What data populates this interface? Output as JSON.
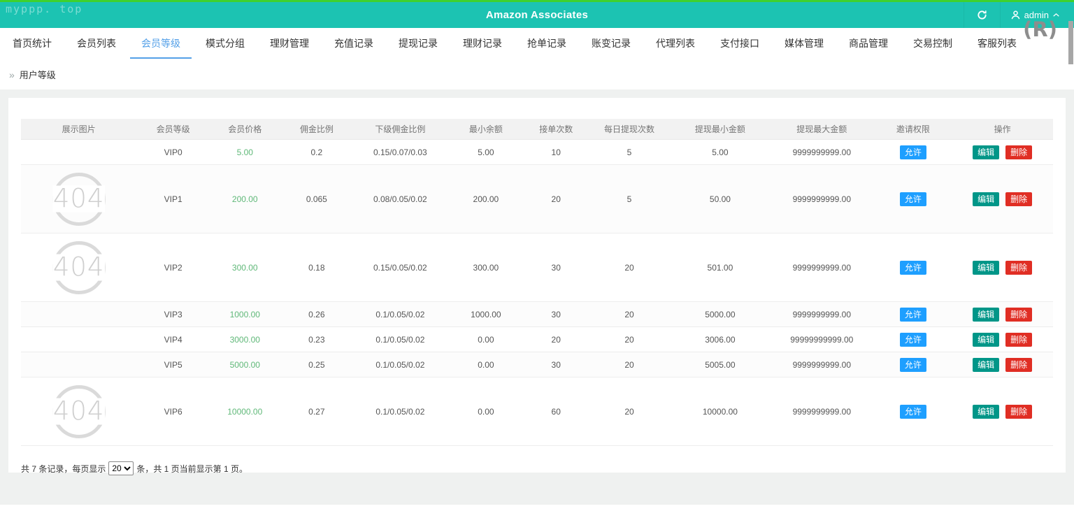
{
  "header": {
    "watermark": "myppp. top",
    "title": "Amazon Associates",
    "admin_label": "admin",
    "corner_watermark": "(R)"
  },
  "nav": {
    "items": [
      {
        "label": "首页统计",
        "active": false
      },
      {
        "label": "会员列表",
        "active": false
      },
      {
        "label": "会员等级",
        "active": true
      },
      {
        "label": "模式分组",
        "active": false
      },
      {
        "label": "理财管理",
        "active": false
      },
      {
        "label": "充值记录",
        "active": false
      },
      {
        "label": "提现记录",
        "active": false
      },
      {
        "label": "理财记录",
        "active": false
      },
      {
        "label": "抢单记录",
        "active": false
      },
      {
        "label": "账变记录",
        "active": false
      },
      {
        "label": "代理列表",
        "active": false
      },
      {
        "label": "支付接口",
        "active": false
      },
      {
        "label": "媒体管理",
        "active": false
      },
      {
        "label": "商品管理",
        "active": false
      },
      {
        "label": "交易控制",
        "active": false
      },
      {
        "label": "客服列表",
        "active": false
      }
    ]
  },
  "breadcrumb": {
    "icon": "»",
    "label": "用户等级"
  },
  "table": {
    "columns": [
      "展示图片",
      "会员等级",
      "会员价格",
      "佣金比例",
      "下级佣金比例",
      "最小余额",
      "接单次数",
      "每日提现次数",
      "提现最小金额",
      "提现最大金额",
      "邀请权限",
      "操作"
    ],
    "actions": {
      "allow": "允许",
      "edit": "编辑",
      "delete": "删除"
    },
    "image_placeholder_text": "404",
    "rows": [
      {
        "has_image": false,
        "level": "VIP0",
        "price": "5.00",
        "commission": "0.2",
        "sub_commission": "0.15/0.07/0.03",
        "min_balance": "5.00",
        "order_count": "10",
        "daily_withdraw_count": "5",
        "min_withdraw": "5.00",
        "max_withdraw": "9999999999.00"
      },
      {
        "has_image": true,
        "level": "VIP1",
        "price": "200.00",
        "commission": "0.065",
        "sub_commission": "0.08/0.05/0.02",
        "min_balance": "200.00",
        "order_count": "20",
        "daily_withdraw_count": "5",
        "min_withdraw": "50.00",
        "max_withdraw": "9999999999.00"
      },
      {
        "has_image": true,
        "level": "VIP2",
        "price": "300.00",
        "commission": "0.18",
        "sub_commission": "0.15/0.05/0.02",
        "min_balance": "300.00",
        "order_count": "30",
        "daily_withdraw_count": "20",
        "min_withdraw": "501.00",
        "max_withdraw": "9999999999.00"
      },
      {
        "has_image": false,
        "level": "VIP3",
        "price": "1000.00",
        "commission": "0.26",
        "sub_commission": "0.1/0.05/0.02",
        "min_balance": "1000.00",
        "order_count": "30",
        "daily_withdraw_count": "20",
        "min_withdraw": "5000.00",
        "max_withdraw": "9999999999.00"
      },
      {
        "has_image": false,
        "level": "VIP4",
        "price": "3000.00",
        "commission": "0.23",
        "sub_commission": "0.1/0.05/0.02",
        "min_balance": "0.00",
        "order_count": "20",
        "daily_withdraw_count": "20",
        "min_withdraw": "3006.00",
        "max_withdraw": "99999999999.00"
      },
      {
        "has_image": false,
        "level": "VIP5",
        "price": "5000.00",
        "commission": "0.25",
        "sub_commission": "0.1/0.05/0.02",
        "min_balance": "0.00",
        "order_count": "30",
        "daily_withdraw_count": "20",
        "min_withdraw": "5005.00",
        "max_withdraw": "9999999999.00"
      },
      {
        "has_image": true,
        "level": "VIP6",
        "price": "10000.00",
        "commission": "0.27",
        "sub_commission": "0.1/0.05/0.02",
        "min_balance": "0.00",
        "order_count": "60",
        "daily_withdraw_count": "20",
        "min_withdraw": "10000.00",
        "max_withdraw": "9999999999.00"
      }
    ]
  },
  "footer": {
    "prefix": "共 7 条记录，每页显示",
    "page_size": "20",
    "suffix": "条，共 1 页当前显示第 1 页。"
  },
  "colors": {
    "header_bg": "#1cc3b2",
    "top_strip": "#3fd12e",
    "active_tab": "#54a0e8",
    "price_green": "#5FB878",
    "allow_blue": "#1E9FFF",
    "edit_green": "#009688",
    "delete_red": "#e02e24"
  }
}
